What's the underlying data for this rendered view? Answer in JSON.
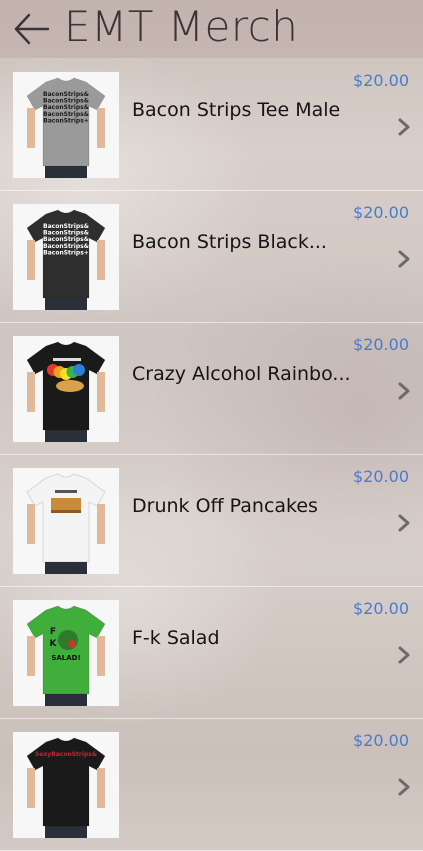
{
  "header": {
    "title": "EMT Merch",
    "back_icon": "back-arrow-icon"
  },
  "colors": {
    "price": "#4a7bd0",
    "title": "#3a3435",
    "chevron": "#6b6b6b"
  },
  "products": [
    {
      "name": "Bacon Strips Tee Male",
      "price": "$20.00",
      "shirt_color": "#9a9a9a",
      "print": "text",
      "print_lines": [
        "BaconStrips&",
        "BaconStrips&",
        "BaconStrips&",
        "BaconStrips&",
        "BaconStrips+"
      ]
    },
    {
      "name": "Bacon Strips Black...",
      "price": "$20.00",
      "shirt_color": "#2e2e2e",
      "print": "text",
      "print_lines": [
        "BaconStrips&",
        "BaconStrips&",
        "BaconStrips&",
        "BaconStrips&",
        "BaconStrips+"
      ]
    },
    {
      "name": "Crazy Alcohol Rainbo...",
      "price": "$20.00",
      "shirt_color": "#1a1a1a",
      "print": "rainbow",
      "print_lines": []
    },
    {
      "name": "Drunk Off Pancakes",
      "price": "$20.00",
      "shirt_color": "#f4f4f4",
      "print": "pancakes",
      "print_lines": []
    },
    {
      "name": "F-k Salad",
      "price": "$20.00",
      "shirt_color": "#3fae3a",
      "print": "salad",
      "print_lines": [
        "F",
        "K",
        "SALAD!"
      ]
    },
    {
      "name": "",
      "price": "$20.00",
      "shirt_color": "#1a1a1a",
      "print": "text-red",
      "print_lines": [
        "SexyBaconStrips&"
      ]
    }
  ]
}
